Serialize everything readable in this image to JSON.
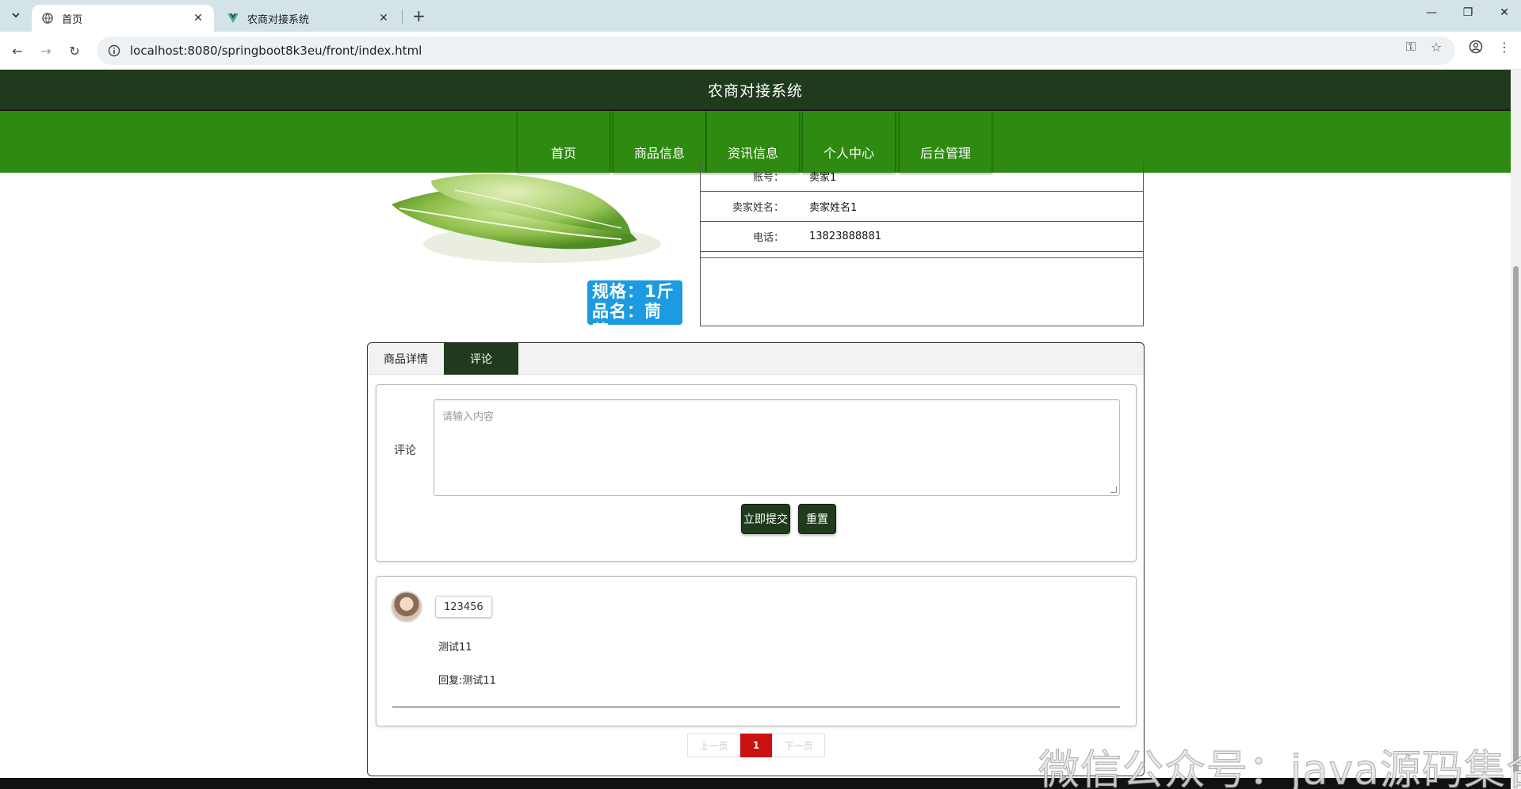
{
  "browser": {
    "tabs": [
      {
        "title": "首页",
        "active": true
      },
      {
        "title": "农商对接系统",
        "active": false
      }
    ],
    "url": "localhost:8080/springboot8k3eu/front/index.html"
  },
  "site": {
    "title": "农商对接系统",
    "nav": [
      "首页",
      "商品信息",
      "资讯信息",
      "个人中心",
      "后台管理"
    ]
  },
  "product": {
    "badge_line1": "规格：1斤",
    "badge_line2": "品名：茼蒿",
    "info": [
      {
        "label": "账号：",
        "value": "卖家1"
      },
      {
        "label": "卖家姓名：",
        "value": "卖家姓名1"
      },
      {
        "label": "电话：",
        "value": "13823888881"
      }
    ]
  },
  "detail_tabs": [
    "商品详情",
    "评论"
  ],
  "comment_form": {
    "label": "评论",
    "placeholder": "请输入内容",
    "submit": "立即提交",
    "reset": "重置"
  },
  "comments": [
    {
      "user": "123456",
      "text": "测试11",
      "reply": "回复:测试11"
    }
  ],
  "pagination": {
    "prev": "上一页",
    "current": "1",
    "next": "下一页"
  },
  "watermark": "微信公众号：java源码集合",
  "colors": {
    "header": "#1f3a1c",
    "nav": "#2e8a10",
    "active_page": "#cc1111",
    "badge": "#1d9be0"
  }
}
